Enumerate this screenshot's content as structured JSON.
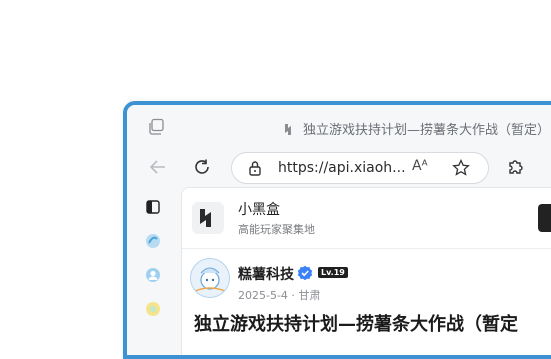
{
  "window": {
    "title": "独立游戏扶持计划—捞薯条大作战（暂定）"
  },
  "toolbar": {
    "url": "https://api.xiaoh...",
    "read_aloud_label": "Aᴬ"
  },
  "app_banner": {
    "name": "小黑盒",
    "subtitle": "高能玩家聚集地"
  },
  "post": {
    "author": "糕薯科技",
    "level": "Lv.19",
    "meta": "2025-5-4 · 甘肃",
    "title": "独立游戏扶持计划—捞薯条大作战（暂定"
  },
  "colors": {
    "window_border": "#3d92d3",
    "verified": "#3b82f6"
  }
}
